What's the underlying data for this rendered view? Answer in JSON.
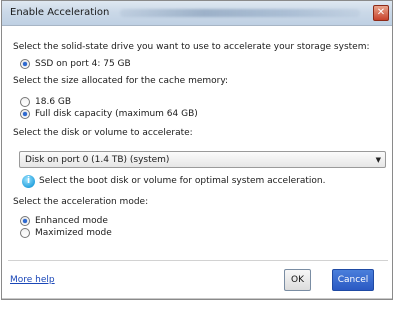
{
  "window": {
    "title": "Enable Acceleration"
  },
  "sections": {
    "ssd_prompt": "Select the solid-state drive you want to use to accelerate your storage system:",
    "ssd_option": "SSD on port 4: 75 GB",
    "size_prompt": "Select the size allocated for the cache memory:",
    "size_options": [
      "18.6 GB",
      "Full disk capacity (maximum 64 GB)"
    ],
    "size_selected": "Full disk capacity (maximum 64 GB)",
    "disk_prompt": "Select the disk or volume to accelerate:",
    "disk_dropdown_value": "Disk on port 0 (1.4 TB) (system)",
    "info_text": "Select the boot disk or volume for optimal system acceleration.",
    "mode_prompt": "Select the acceleration mode:",
    "mode_options": [
      "Enhanced mode",
      "Maximized mode"
    ],
    "mode_selected": "Enhanced mode"
  },
  "footer": {
    "more_help": "More help",
    "ok": "OK",
    "cancel": "Cancel"
  },
  "colors": {
    "link": "#1a47b8",
    "primary_button": "#2b59c3",
    "radio_selected": "#2e6ad1"
  }
}
